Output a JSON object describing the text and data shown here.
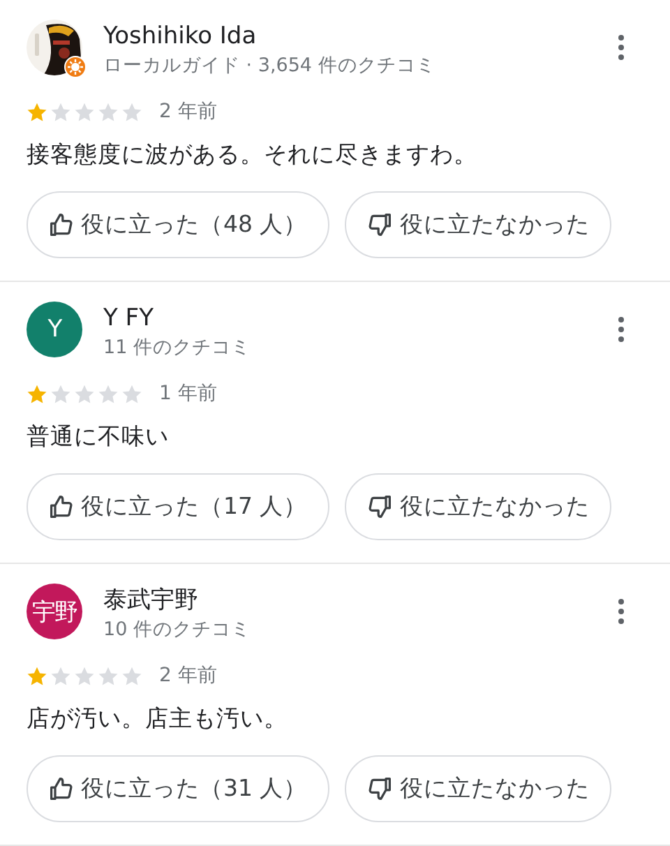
{
  "reviews": [
    {
      "avatar": {
        "kind": "picture",
        "guide_badge": true
      },
      "name": "Yoshihiko Ida",
      "subtitle": "ローカルガイド · 3,654 件のクチコミ",
      "stars": 1,
      "time": "2 年前",
      "text": "接客態度に波がある。それに尽きますわ。",
      "helpful": "役に立った（48 人）",
      "not_helpful": "役に立たなかった"
    },
    {
      "avatar": {
        "kind": "letters",
        "letters": "Y",
        "color": "#12806b"
      },
      "name": "Y FY",
      "subtitle": "11 件のクチコミ",
      "stars": 1,
      "time": "1 年前",
      "text": "普通に不味い",
      "helpful": "役に立った（17 人）",
      "not_helpful": "役に立たなかった"
    },
    {
      "avatar": {
        "kind": "letters",
        "letters": "宇野",
        "color": "#c2185b"
      },
      "name": "泰武宇野",
      "subtitle": "10 件のクチコミ",
      "stars": 1,
      "time": "2 年前",
      "text": "店が汚い。店主も汚い。",
      "helpful": "役に立った（31 人）",
      "not_helpful": "役に立たなかった"
    }
  ]
}
